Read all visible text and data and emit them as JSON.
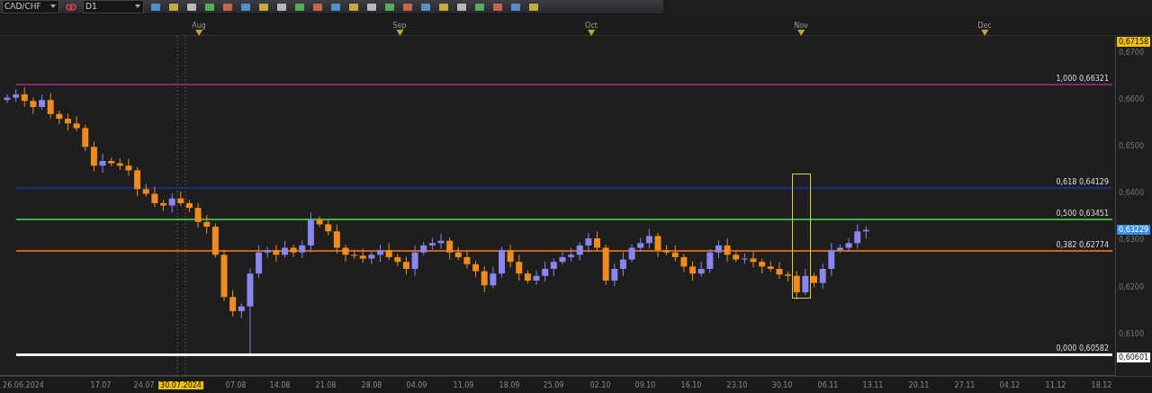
{
  "toolbar": {
    "symbol": "CAD/CHF",
    "timeframe": "D1"
  },
  "months": [
    "Aug",
    "Sep",
    "Oct",
    "Nov",
    "Dec"
  ],
  "fib_levels": [
    {
      "label": "1,000 0,66321",
      "color": "#7a2f72"
    },
    {
      "label": "0,618 0,64129",
      "color": "#1c2a8c"
    },
    {
      "label": "0,500 0,63451",
      "color": "#3db03d"
    },
    {
      "label": "0,382 0,62774",
      "color": "#c8641c"
    },
    {
      "label": "0,000 0,60582",
      "color": "#f0f0f0"
    }
  ],
  "price_axis": {
    "labels": [
      "0,6700",
      "0,6600",
      "0,6500",
      "0,6400",
      "0,6300",
      "0,6200",
      "0,6100"
    ],
    "tags": [
      {
        "text": "0,67158",
        "color": "#f2c200"
      },
      {
        "text": "0,63229",
        "color": "#3a8ee6"
      },
      {
        "text": "0,60601",
        "color": "#ffffff"
      }
    ]
  },
  "date_axis": [
    {
      "label": "26.06.2024",
      "selected": false
    },
    {
      "label": "17.07",
      "selected": false
    },
    {
      "label": "24.07",
      "selected": false
    },
    {
      "label": "30.07.2024",
      "selected": true
    },
    {
      "label": "07.08",
      "selected": false
    },
    {
      "label": "14.08",
      "selected": false
    },
    {
      "label": "21.08",
      "selected": false
    },
    {
      "label": "28.08",
      "selected": false
    },
    {
      "label": "04.09",
      "selected": false
    },
    {
      "label": "11.09",
      "selected": false
    },
    {
      "label": "18.09",
      "selected": false
    },
    {
      "label": "25.09",
      "selected": false
    },
    {
      "label": "02.10",
      "selected": false
    },
    {
      "label": "09.10",
      "selected": false
    },
    {
      "label": "16.10",
      "selected": false
    },
    {
      "label": "23.10",
      "selected": false
    },
    {
      "label": "30.10",
      "selected": false
    },
    {
      "label": "06.11",
      "selected": false
    },
    {
      "label": "13.11",
      "selected": false
    },
    {
      "label": "20.11",
      "selected": false
    },
    {
      "label": "27.11",
      "selected": false
    },
    {
      "label": "04.12",
      "selected": false
    },
    {
      "label": "11.12",
      "selected": false
    },
    {
      "label": "18.12",
      "selected": false
    }
  ]
}
